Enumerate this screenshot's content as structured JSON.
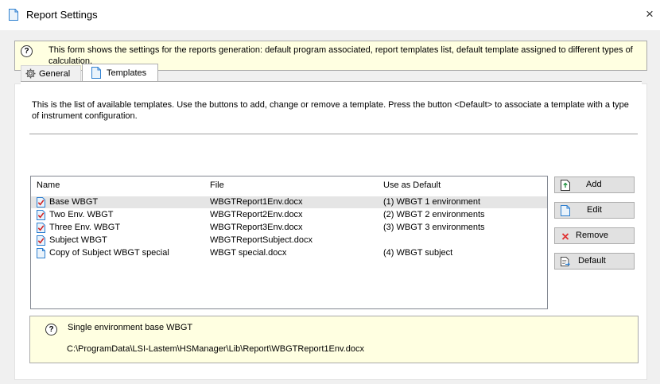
{
  "window": {
    "title": "Report Settings",
    "close_glyph": "×",
    "icon": "document-icon"
  },
  "info": {
    "icon": "help-icon",
    "glyph": "?",
    "text": "This form shows the settings for the reports generation: default program associated, report templates list, default template assigned to different types of calculation."
  },
  "tabs": [
    {
      "label": "General",
      "icon": "settings-icon",
      "active": false
    },
    {
      "label": "Templates",
      "icon": "document-icon",
      "active": true
    }
  ],
  "templates_page": {
    "description": "This is the list of available templates. Use the buttons to add, change or remove a template. Press the button <Default> to associate a template with a type of instrument configuration.",
    "columns": [
      "Name",
      "File",
      "Use as Default"
    ],
    "rows": [
      {
        "name": "Base WBGT",
        "file": "WBGTReport1Env.docx",
        "default": "(1) WBGT 1 environment",
        "checked": true,
        "selected": true
      },
      {
        "name": "Two Env. WBGT",
        "file": "WBGTReport2Env.docx",
        "default": "(2) WBGT 2 environments",
        "checked": true,
        "selected": false
      },
      {
        "name": "Three Env. WBGT",
        "file": "WBGTReport3Env.docx",
        "default": "(3) WBGT 3 environments",
        "checked": true,
        "selected": false
      },
      {
        "name": "Subject WBGT",
        "file": "WBGTReportSubject.docx",
        "default": "",
        "checked": true,
        "selected": false
      },
      {
        "name": "Copy of  Subject WBGT special",
        "file": "WBGT special.docx",
        "default": "(4) WBGT subject",
        "checked": false,
        "selected": false
      }
    ],
    "buttons": {
      "add": "Add",
      "edit": "Edit",
      "remove": "Remove",
      "default": "Default"
    },
    "detail": {
      "title": "Single environment base WBGT",
      "path": "C:\\ProgramData\\LSI-Lastem\\HSManager\\Lib\\Report\\WBGTReport1Env.docx"
    }
  },
  "colors": {
    "info_background": "#ffffe1",
    "selection": "#e5e5e5",
    "check_red": "#d02020",
    "remove_red": "#e03030",
    "icon_blue": "#2d7fd0"
  }
}
